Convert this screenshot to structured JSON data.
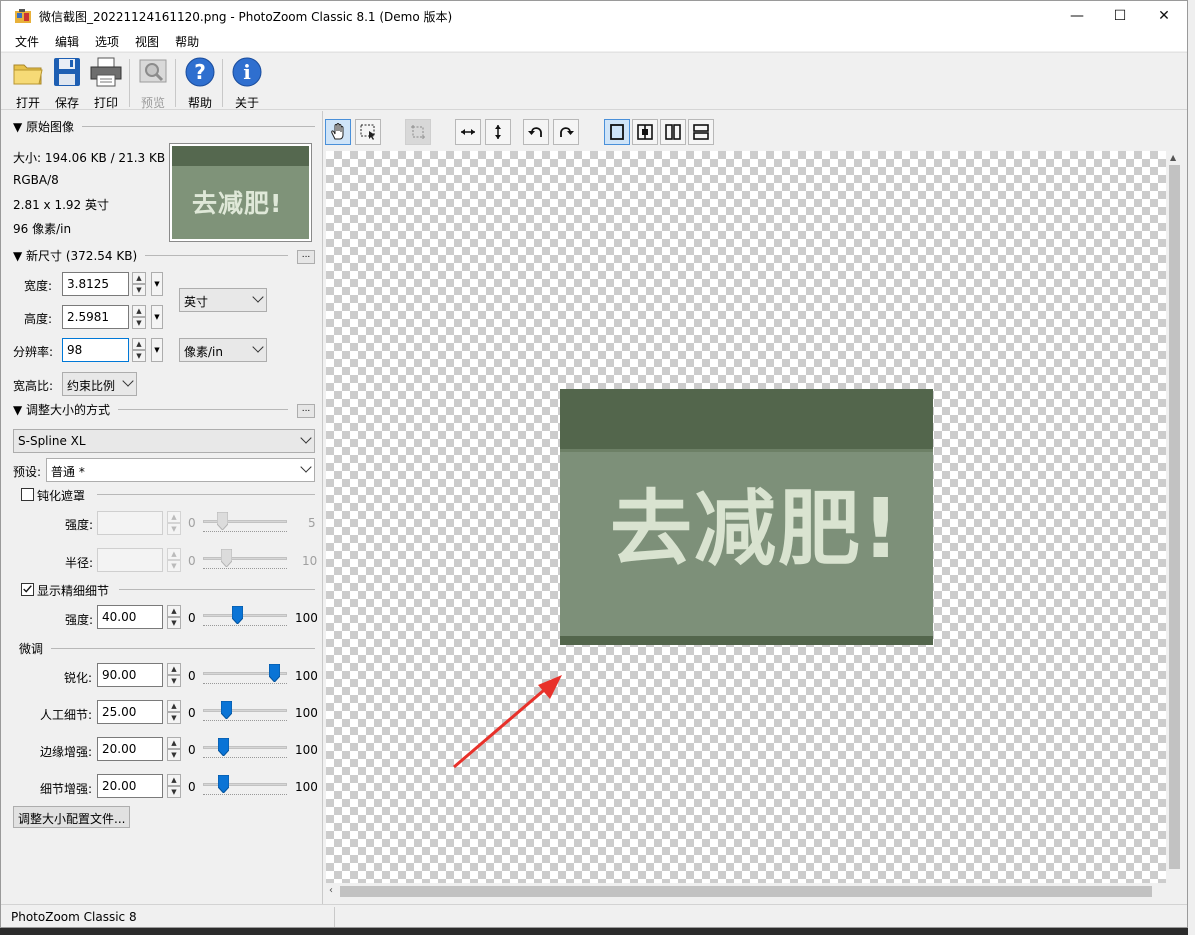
{
  "window": {
    "title": "微信截图_20221124161120.png - PhotoZoom Classic 8.1 (Demo 版本)"
  },
  "menu": [
    "文件",
    "编辑",
    "选项",
    "视图",
    "帮助"
  ],
  "toolbar": {
    "open": "打开",
    "save": "保存",
    "print": "打印",
    "preview": "预览",
    "help": "帮助",
    "about": "关于"
  },
  "original": {
    "header": "▼ 原始图像",
    "size": "大小: 194.06 KB / 21.3 KB",
    "mode": "RGBA/8",
    "dims": "2.81 x 1.92 英寸",
    "res": "96 像素/in",
    "thumb_text": "去减肥!"
  },
  "newsize": {
    "header": "▼ 新尺寸 (372.54 KB)",
    "more": "...",
    "width_label": "宽度:",
    "width": "3.8125",
    "height_label": "高度:",
    "height": "2.5981",
    "res_label": "分辨率:",
    "res": "98",
    "unit": "英寸",
    "res_unit": "像素/in",
    "ratio_label": "宽高比:",
    "ratio": "约束比例"
  },
  "method": {
    "header": "▼ 调整大小的方式",
    "more": "...",
    "algorithm": "S-Spline XL",
    "preset_label": "预设:",
    "preset": "普通 *"
  },
  "unsharp": {
    "label": "钝化遮罩",
    "checked": false,
    "strength_label": "强度:",
    "strength_min": "0",
    "strength_max": "5",
    "radius_label": "半径:",
    "radius_min": "0",
    "radius_max": "10"
  },
  "detail": {
    "label": "显示精细细节",
    "checked": true,
    "strength_label": "强度:",
    "strength": "40.00",
    "min": "0",
    "max": "100",
    "level": 0.4
  },
  "finetune": {
    "header": "微调",
    "rows": [
      {
        "label": "锐化:",
        "value": "90.00",
        "min": "0",
        "max": "100",
        "level": 0.9
      },
      {
        "label": "人工细节:",
        "value": "25.00",
        "min": "0",
        "max": "100",
        "level": 0.25
      },
      {
        "label": "边缘增强:",
        "value": "20.00",
        "min": "0",
        "max": "100",
        "level": 0.2
      },
      {
        "label": "细节增强:",
        "value": "20.00",
        "min": "0",
        "max": "100",
        "level": 0.2
      }
    ]
  },
  "profile_button": "调整大小配置文件...",
  "preview_text": "去减肥!",
  "status": "PhotoZoom Classic 8",
  "colors": {
    "accent": "#0078d7",
    "image_bg": "#7d9079",
    "image_band": "#53664c",
    "arrow": "#e8312a"
  }
}
